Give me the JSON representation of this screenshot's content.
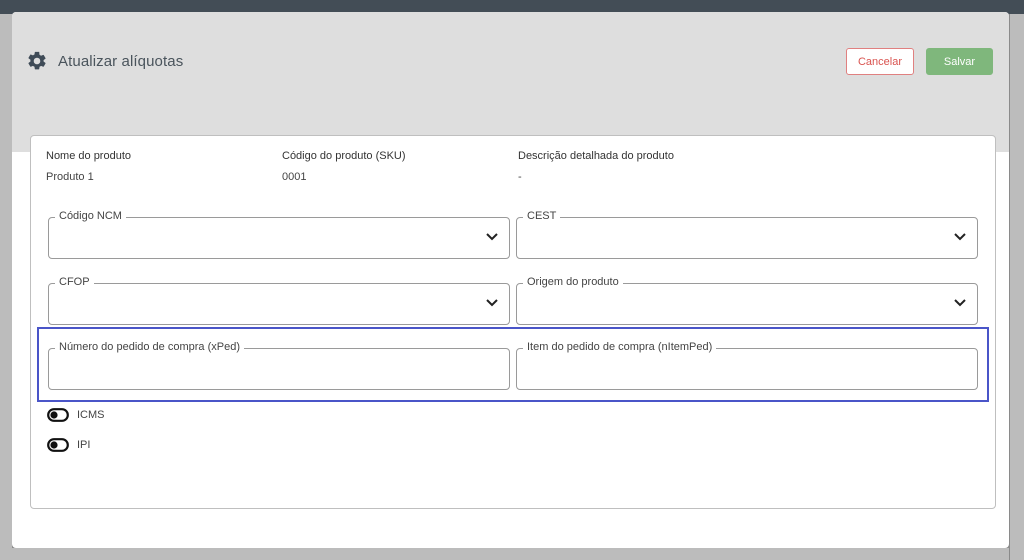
{
  "header": {
    "title": "Atualizar alíquotas",
    "title_icon": "gear-icon",
    "cancel_label": "Cancelar",
    "save_label": "Salvar"
  },
  "product_info": {
    "name_label": "Nome do produto",
    "name_value": "Produto 1",
    "sku_label": "Código do produto (SKU)",
    "sku_value": "0001",
    "description_label": "Descrição detalhada do produto",
    "description_value": "-"
  },
  "fields": {
    "ncm": {
      "label": "Código NCM",
      "value": ""
    },
    "cest": {
      "label": "CEST",
      "value": ""
    },
    "cfop": {
      "label": "CFOP",
      "value": ""
    },
    "origem": {
      "label": "Origem do produto",
      "value": ""
    },
    "xped": {
      "label": "Número do pedido de compra (xPed)",
      "value": ""
    },
    "nitemped": {
      "label": "Item do pedido de compra (nItemPed)",
      "value": ""
    }
  },
  "toggles": {
    "icms": {
      "label": "ICMS",
      "enabled": false
    },
    "ipi": {
      "label": "IPI",
      "enabled": false
    }
  },
  "colors": {
    "cancel": "#d9534f",
    "save": "#7fb77c",
    "highlight": "#4a55c8",
    "header_bg": "#dedede"
  }
}
